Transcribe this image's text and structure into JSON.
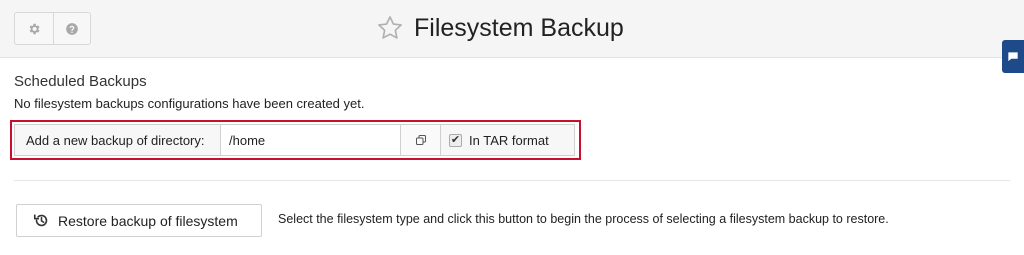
{
  "header": {
    "title": "Filesystem Backup",
    "icons": [
      "gear-icon",
      "help-icon",
      "star-icon",
      "chat-icon"
    ]
  },
  "scheduled": {
    "section_title": "Scheduled Backups",
    "empty_message": "No filesystem backups configurations have been created yet."
  },
  "add_backup": {
    "label": "Add a new backup of directory:",
    "directory_value": "/home",
    "tar_label": "In TAR format",
    "tar_checked": true,
    "checkmark": "✔"
  },
  "restore": {
    "button_label": "Restore backup of filesystem",
    "help_text": "Select the filesystem type and click this button to begin the process of selecting a filesystem backup to restore."
  },
  "colors": {
    "highlight": "#c8102e",
    "side_tab": "#1f4a8a"
  }
}
